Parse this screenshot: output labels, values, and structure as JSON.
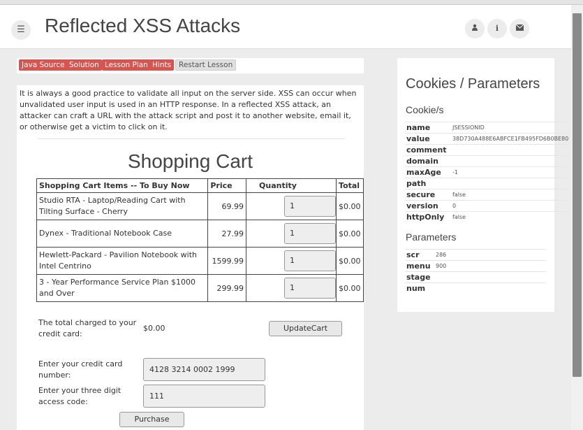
{
  "header": {
    "title": "Reflected XSS Attacks",
    "menu_icon": "hamburger-icon",
    "icons": [
      "user-icon",
      "info-icon",
      "envelope-icon"
    ]
  },
  "lesson_buttons": [
    "Java Source",
    "Solution",
    "Lesson Plan",
    "Hints",
    "Restart Lesson"
  ],
  "intro": "It is always a good practice to validate all input on the server side. XSS can occur when unvalidated user input is used in an HTTP response. In a reflected XSS attack, an attacker can craft a URL with the attack script and post it to another website, email it, or otherwise get a victim to click on it.",
  "cart": {
    "title": "Shopping Cart",
    "headers": [
      "Shopping Cart Items -- To Buy Now",
      "Price",
      "Quantity",
      "Total"
    ],
    "rows": [
      {
        "item": "Studio RTA - Laptop/Reading Cart with Tilting Surface - Cherry",
        "price": "69.99",
        "qty": "1",
        "total": "$0.00"
      },
      {
        "item": "Dynex - Traditional Notebook Case",
        "price": "27.99",
        "qty": "1",
        "total": "$0.00"
      },
      {
        "item": "Hewlett-Packard - Pavilion Notebook with Intel Centrino",
        "price": "1599.99",
        "qty": "1",
        "total": "$0.00"
      },
      {
        "item": "3 - Year Performance Service Plan $1000 and Over",
        "price": "299.99",
        "qty": "1",
        "total": "$0.00"
      }
    ],
    "total_label": "The total charged to your credit card:",
    "total_value": "$0.00",
    "update_button": "UpdateCart",
    "cc_label": "Enter your credit card number:",
    "cc_value": "4128 3214 0002 1999",
    "code_label": "Enter your three digit access code:",
    "code_value": "111",
    "purchase_button": "Purchase"
  },
  "sidebar": {
    "title": "Cookies / Parameters",
    "cookies_heading": "Cookie/s",
    "cookies": [
      {
        "key": "name",
        "value": "JSESSIONID"
      },
      {
        "key": "value",
        "value": "38D730A488E6ABFCE1FB495FD6B0BE80"
      },
      {
        "key": "comment",
        "value": ""
      },
      {
        "key": "domain",
        "value": ""
      },
      {
        "key": "maxAge",
        "value": "-1"
      },
      {
        "key": "path",
        "value": ""
      },
      {
        "key": "secure",
        "value": "false"
      },
      {
        "key": "version",
        "value": "0"
      },
      {
        "key": "httpOnly",
        "value": "false"
      }
    ],
    "params_heading": "Parameters",
    "params": [
      {
        "key": "scr",
        "value": "286"
      },
      {
        "key": "menu",
        "value": "900"
      },
      {
        "key": "stage",
        "value": ""
      },
      {
        "key": "num",
        "value": ""
      }
    ]
  }
}
